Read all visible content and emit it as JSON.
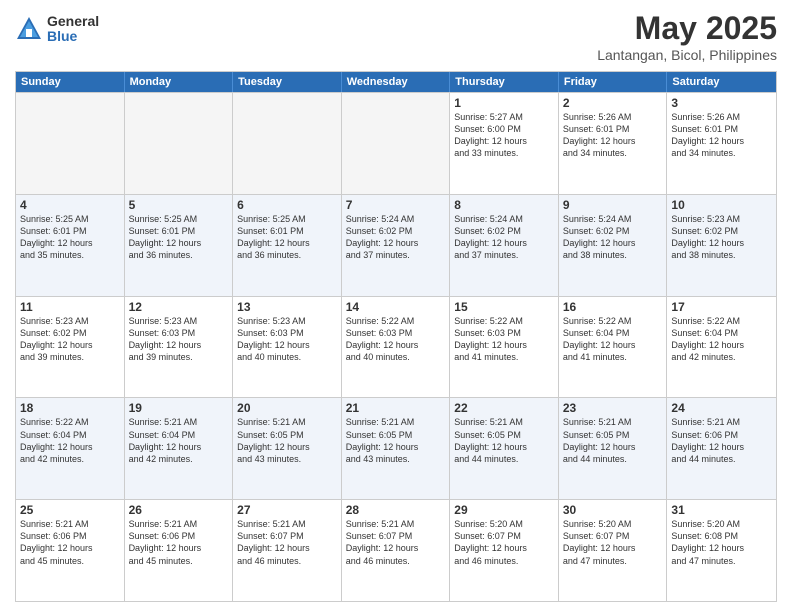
{
  "logo": {
    "general": "General",
    "blue": "Blue"
  },
  "title": "May 2025",
  "location": "Lantangan, Bicol, Philippines",
  "weekdays": [
    "Sunday",
    "Monday",
    "Tuesday",
    "Wednesday",
    "Thursday",
    "Friday",
    "Saturday"
  ],
  "rows": [
    [
      {
        "day": "",
        "info": "",
        "empty": true
      },
      {
        "day": "",
        "info": "",
        "empty": true
      },
      {
        "day": "",
        "info": "",
        "empty": true
      },
      {
        "day": "",
        "info": "",
        "empty": true
      },
      {
        "day": "1",
        "info": "Sunrise: 5:27 AM\nSunset: 6:00 PM\nDaylight: 12 hours\nand 33 minutes."
      },
      {
        "day": "2",
        "info": "Sunrise: 5:26 AM\nSunset: 6:01 PM\nDaylight: 12 hours\nand 34 minutes."
      },
      {
        "day": "3",
        "info": "Sunrise: 5:26 AM\nSunset: 6:01 PM\nDaylight: 12 hours\nand 34 minutes."
      }
    ],
    [
      {
        "day": "4",
        "info": "Sunrise: 5:25 AM\nSunset: 6:01 PM\nDaylight: 12 hours\nand 35 minutes."
      },
      {
        "day": "5",
        "info": "Sunrise: 5:25 AM\nSunset: 6:01 PM\nDaylight: 12 hours\nand 36 minutes."
      },
      {
        "day": "6",
        "info": "Sunrise: 5:25 AM\nSunset: 6:01 PM\nDaylight: 12 hours\nand 36 minutes."
      },
      {
        "day": "7",
        "info": "Sunrise: 5:24 AM\nSunset: 6:02 PM\nDaylight: 12 hours\nand 37 minutes."
      },
      {
        "day": "8",
        "info": "Sunrise: 5:24 AM\nSunset: 6:02 PM\nDaylight: 12 hours\nand 37 minutes."
      },
      {
        "day": "9",
        "info": "Sunrise: 5:24 AM\nSunset: 6:02 PM\nDaylight: 12 hours\nand 38 minutes."
      },
      {
        "day": "10",
        "info": "Sunrise: 5:23 AM\nSunset: 6:02 PM\nDaylight: 12 hours\nand 38 minutes."
      }
    ],
    [
      {
        "day": "11",
        "info": "Sunrise: 5:23 AM\nSunset: 6:02 PM\nDaylight: 12 hours\nand 39 minutes."
      },
      {
        "day": "12",
        "info": "Sunrise: 5:23 AM\nSunset: 6:03 PM\nDaylight: 12 hours\nand 39 minutes."
      },
      {
        "day": "13",
        "info": "Sunrise: 5:23 AM\nSunset: 6:03 PM\nDaylight: 12 hours\nand 40 minutes."
      },
      {
        "day": "14",
        "info": "Sunrise: 5:22 AM\nSunset: 6:03 PM\nDaylight: 12 hours\nand 40 minutes."
      },
      {
        "day": "15",
        "info": "Sunrise: 5:22 AM\nSunset: 6:03 PM\nDaylight: 12 hours\nand 41 minutes."
      },
      {
        "day": "16",
        "info": "Sunrise: 5:22 AM\nSunset: 6:04 PM\nDaylight: 12 hours\nand 41 minutes."
      },
      {
        "day": "17",
        "info": "Sunrise: 5:22 AM\nSunset: 6:04 PM\nDaylight: 12 hours\nand 42 minutes."
      }
    ],
    [
      {
        "day": "18",
        "info": "Sunrise: 5:22 AM\nSunset: 6:04 PM\nDaylight: 12 hours\nand 42 minutes."
      },
      {
        "day": "19",
        "info": "Sunrise: 5:21 AM\nSunset: 6:04 PM\nDaylight: 12 hours\nand 42 minutes."
      },
      {
        "day": "20",
        "info": "Sunrise: 5:21 AM\nSunset: 6:05 PM\nDaylight: 12 hours\nand 43 minutes."
      },
      {
        "day": "21",
        "info": "Sunrise: 5:21 AM\nSunset: 6:05 PM\nDaylight: 12 hours\nand 43 minutes."
      },
      {
        "day": "22",
        "info": "Sunrise: 5:21 AM\nSunset: 6:05 PM\nDaylight: 12 hours\nand 44 minutes."
      },
      {
        "day": "23",
        "info": "Sunrise: 5:21 AM\nSunset: 6:05 PM\nDaylight: 12 hours\nand 44 minutes."
      },
      {
        "day": "24",
        "info": "Sunrise: 5:21 AM\nSunset: 6:06 PM\nDaylight: 12 hours\nand 44 minutes."
      }
    ],
    [
      {
        "day": "25",
        "info": "Sunrise: 5:21 AM\nSunset: 6:06 PM\nDaylight: 12 hours\nand 45 minutes."
      },
      {
        "day": "26",
        "info": "Sunrise: 5:21 AM\nSunset: 6:06 PM\nDaylight: 12 hours\nand 45 minutes."
      },
      {
        "day": "27",
        "info": "Sunrise: 5:21 AM\nSunset: 6:07 PM\nDaylight: 12 hours\nand 46 minutes."
      },
      {
        "day": "28",
        "info": "Sunrise: 5:21 AM\nSunset: 6:07 PM\nDaylight: 12 hours\nand 46 minutes."
      },
      {
        "day": "29",
        "info": "Sunrise: 5:20 AM\nSunset: 6:07 PM\nDaylight: 12 hours\nand 46 minutes."
      },
      {
        "day": "30",
        "info": "Sunrise: 5:20 AM\nSunset: 6:07 PM\nDaylight: 12 hours\nand 47 minutes."
      },
      {
        "day": "31",
        "info": "Sunrise: 5:20 AM\nSunset: 6:08 PM\nDaylight: 12 hours\nand 47 minutes."
      }
    ]
  ]
}
